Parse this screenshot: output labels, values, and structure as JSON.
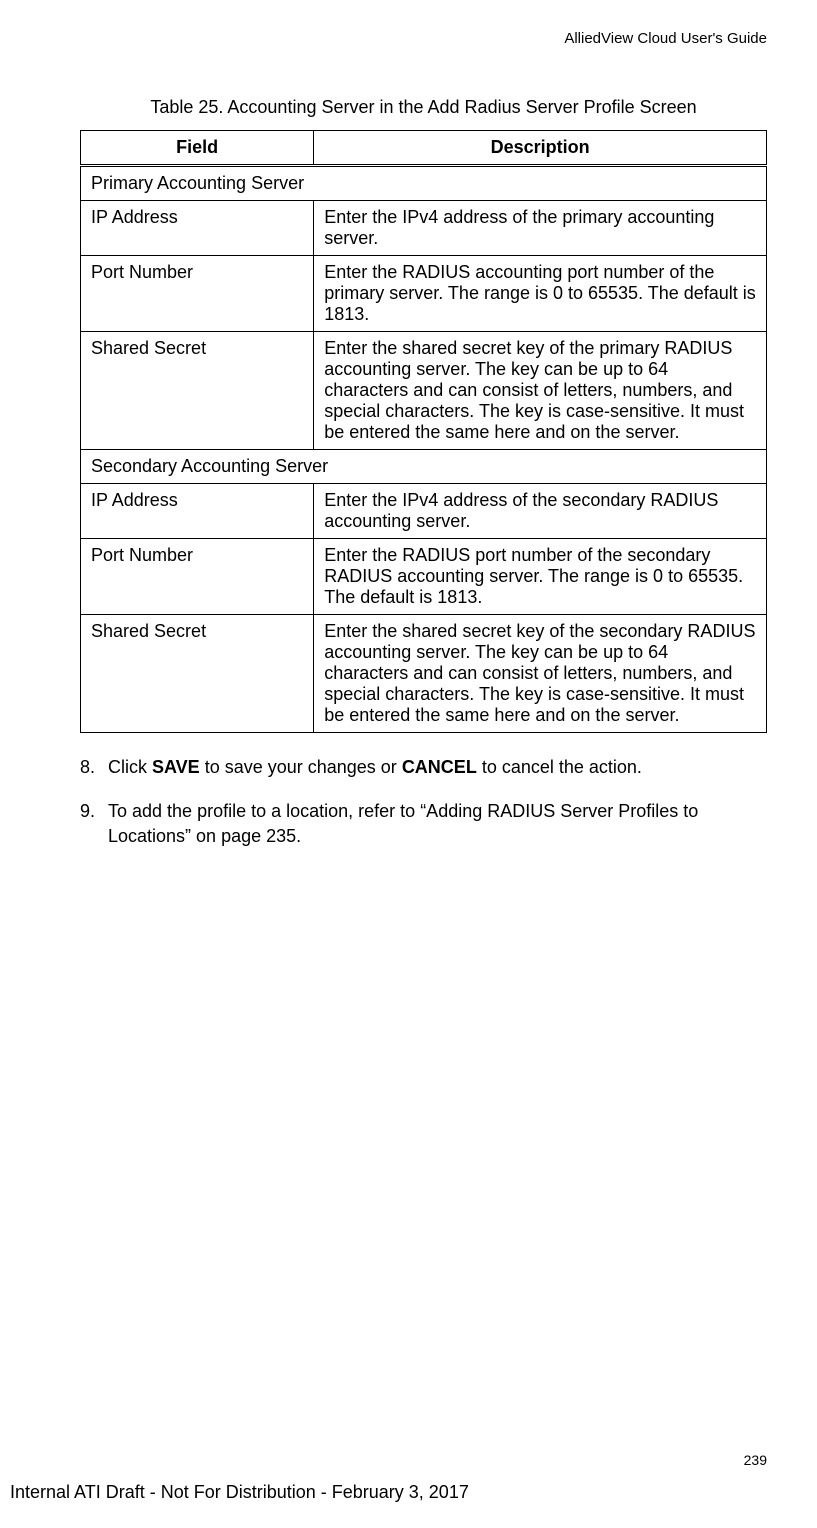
{
  "header": {
    "guide_title": "AlliedView Cloud User's Guide"
  },
  "table": {
    "caption": "Table 25. Accounting Server in the Add Radius Server Profile Screen",
    "headers": {
      "field": "Field",
      "description": "Description"
    },
    "rows": [
      {
        "type": "section",
        "label": "Primary Accounting Server"
      },
      {
        "type": "row",
        "field": "IP Address",
        "description": "Enter the IPv4 address of the primary accounting server."
      },
      {
        "type": "row",
        "field": "Port Number",
        "description": "Enter the RADIUS accounting port number of the primary server. The range is 0 to 65535. The default is 1813."
      },
      {
        "type": "row",
        "field": "Shared Secret",
        "description": "Enter the shared secret key of the primary RADIUS accounting server. The key can be up to 64 characters and can consist of letters, numbers, and special characters. The key is case-sensitive. It must be entered the same here and on the server."
      },
      {
        "type": "section",
        "label": "Secondary Accounting Server"
      },
      {
        "type": "row",
        "field": "IP Address",
        "description": "Enter the IPv4 address of the secondary RADIUS accounting server."
      },
      {
        "type": "row",
        "field": "Port Number",
        "description": "Enter the RADIUS port number of the secondary RADIUS accounting server. The range is 0 to 65535. The default is 1813."
      },
      {
        "type": "row",
        "field": "Shared Secret",
        "description": "Enter the shared secret key of the secondary RADIUS accounting server. The key can be up to 64 characters and can consist of letters, numbers, and special characters. The key is case-sensitive. It must be entered the same here and on the server."
      }
    ]
  },
  "steps": {
    "s8": {
      "num": "8.",
      "pre": "Click ",
      "b1": "SAVE",
      "mid": " to save your changes or ",
      "b2": "CANCEL",
      "post": " to cancel the action."
    },
    "s9": {
      "num": "9.",
      "text": "To add the profile to a location, refer to “Adding RADIUS Server Profiles to Locations” on page 235."
    }
  },
  "footer": {
    "page_number": "239",
    "draft_notice": "Internal ATI Draft - Not For Distribution - February 3, 2017"
  }
}
